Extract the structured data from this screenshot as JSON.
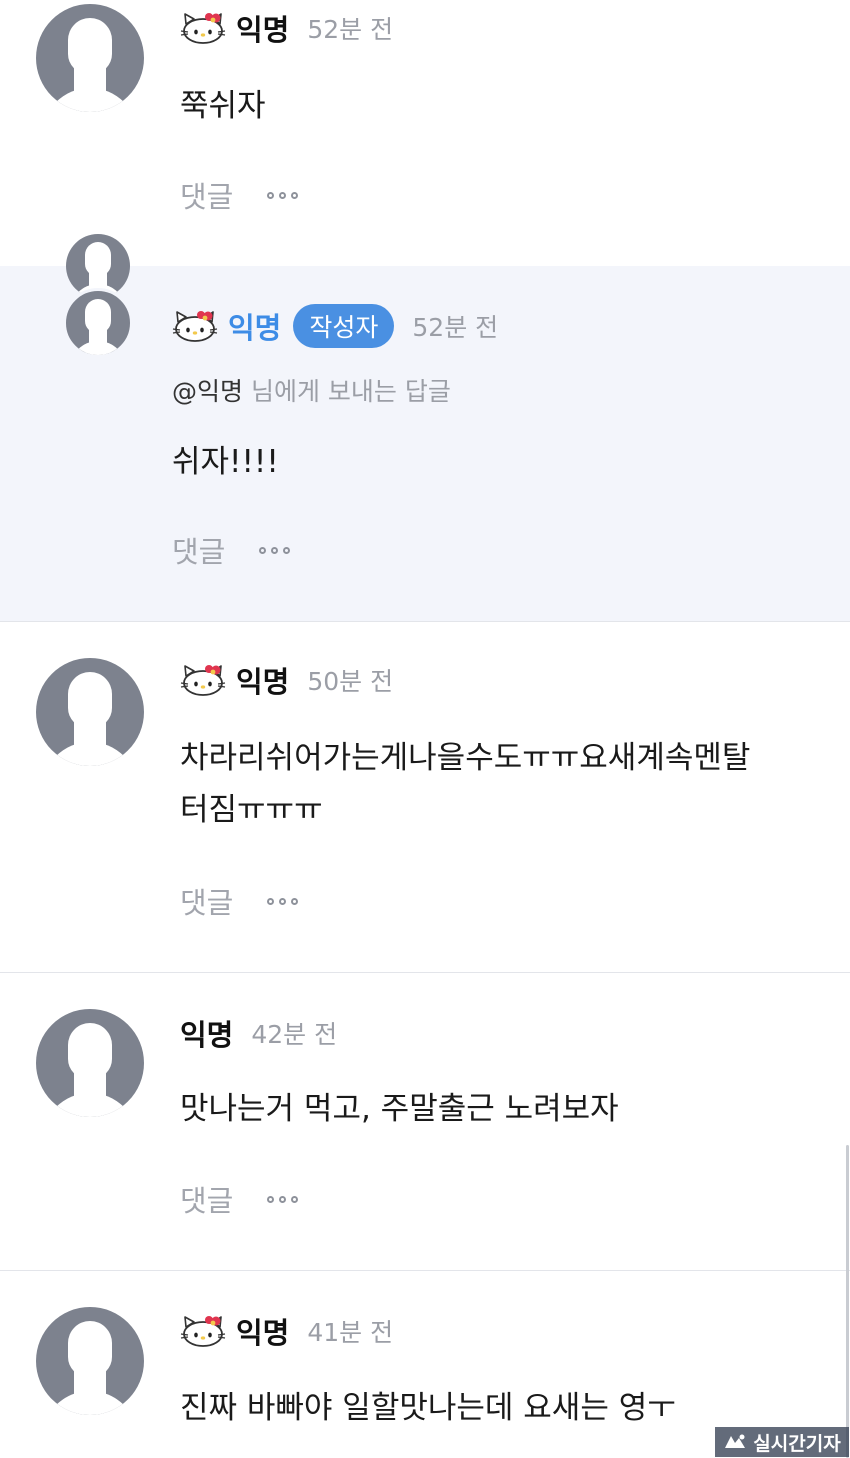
{
  "comments": [
    {
      "author": "익명",
      "time": "52분 전",
      "text": "쭉쉬자",
      "reply_label": "댓글",
      "icon": "hello-kitty-icon"
    },
    {
      "author": "익명",
      "author_badge": "작성자",
      "time": "52분 전",
      "mention_target": "@익명",
      "mention_suffix": " 님에게 보내는 답글",
      "text": "쉬자!!!!",
      "reply_label": "댓글",
      "icon": "hello-kitty-icon"
    },
    {
      "author": "익명",
      "time": "50분 전",
      "text_line1": "차라리쉬어가는게나을수도ㅠㅠ요새계속멘탈",
      "text_line2": "터짐ㅠㅠㅠ",
      "reply_label": "댓글",
      "icon": "hello-kitty-icon"
    },
    {
      "author": "익명",
      "time": "42분 전",
      "text": "맛나는거 먹고, 주말출근 노려보자",
      "reply_label": "댓글"
    },
    {
      "author": "익명",
      "time": "41분 전",
      "text": "진짜 바빠야 일할맛나는데 요새는 영ㅜ",
      "icon": "hello-kitty-icon"
    }
  ],
  "watermark": {
    "text": "실시간기자"
  },
  "colors": {
    "reply_background": "#f3f5fb",
    "badge": "#4a90e2",
    "author_highlight": "#3d8ce6"
  }
}
